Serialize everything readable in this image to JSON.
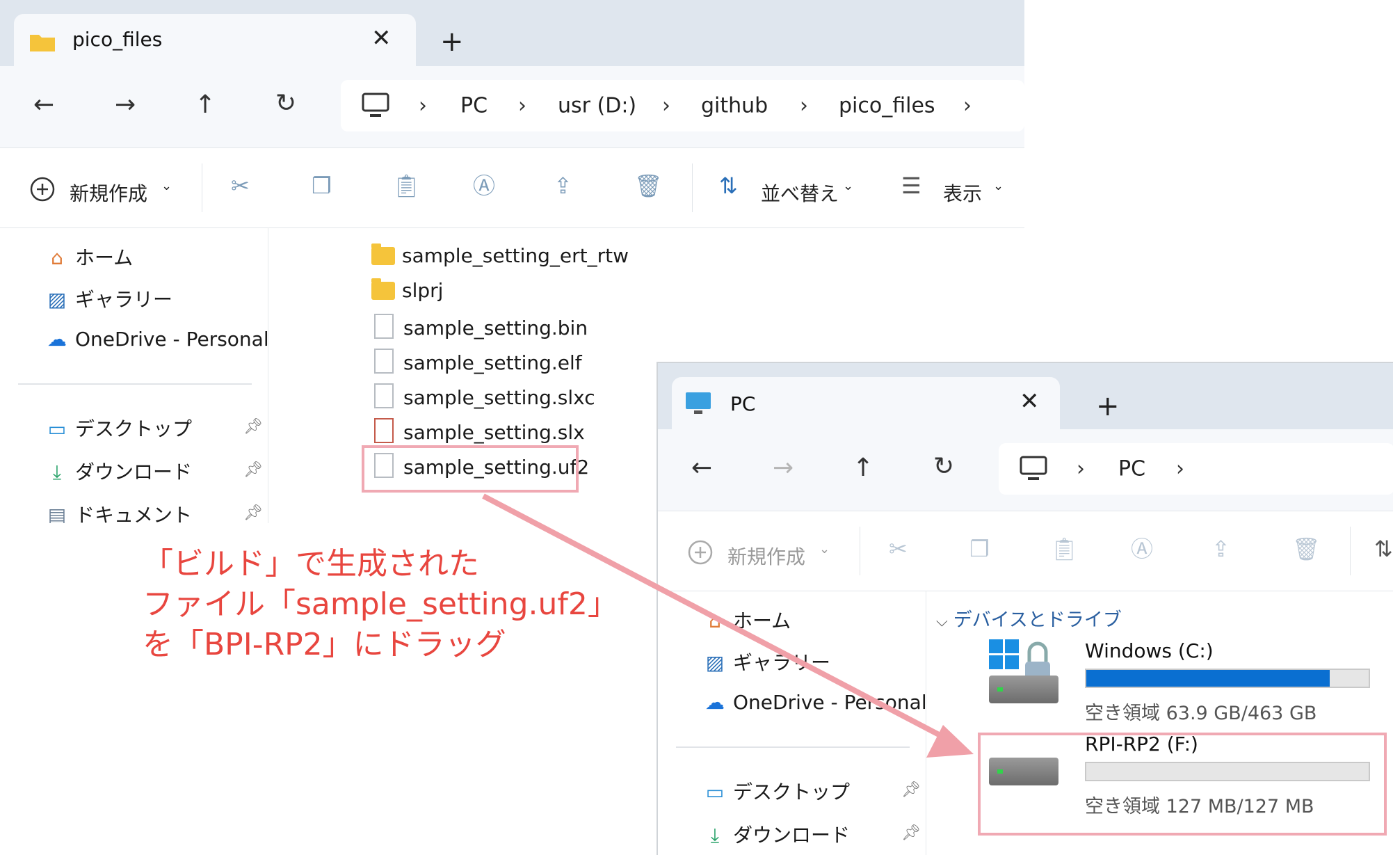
{
  "window1": {
    "tab_title": "pico_files",
    "tab_close": "✕",
    "tab_add": "+",
    "nav": {
      "back": "←",
      "forward": "→",
      "up": "↑",
      "refresh": "↻"
    },
    "breadcrumb": [
      "PC",
      "usr (D:)",
      "github",
      "pico_files"
    ],
    "chevron": "›",
    "commands": {
      "new": "新規作成",
      "sort": "並べ替え",
      "view": "表示"
    },
    "sidebar": [
      {
        "label": "ホーム",
        "icon": "home-icon"
      },
      {
        "label": "ギャラリー",
        "icon": "gallery-icon"
      },
      {
        "label": "OneDrive - Personal",
        "icon": "onedrive-icon"
      },
      {
        "label": "デスクトップ",
        "icon": "desktop-icon"
      },
      {
        "label": "ダウンロード",
        "icon": "download-icon"
      },
      {
        "label": "ドキュメント",
        "icon": "document-icon"
      }
    ],
    "files": [
      {
        "name": "sample_setting_ert_rtw",
        "type": "folder"
      },
      {
        "name": "slprj",
        "type": "folder"
      },
      {
        "name": "sample_setting.bin",
        "type": "file"
      },
      {
        "name": "sample_setting.elf",
        "type": "file"
      },
      {
        "name": "sample_setting.slxc",
        "type": "file"
      },
      {
        "name": "sample_setting.slx",
        "type": "simulink"
      },
      {
        "name": "sample_setting.uf2",
        "type": "file"
      }
    ]
  },
  "window2": {
    "tab_title": "PC",
    "tab_close": "✕",
    "tab_add": "+",
    "breadcrumb": [
      "PC"
    ],
    "commands": {
      "new": "新規作成"
    },
    "sidebar": [
      {
        "label": "ホーム",
        "icon": "home-icon"
      },
      {
        "label": "ギャラリー",
        "icon": "gallery-icon"
      },
      {
        "label": "OneDrive - Personal",
        "icon": "onedrive-icon"
      },
      {
        "label": "デスクトップ",
        "icon": "desktop-icon"
      },
      {
        "label": "ダウンロード",
        "icon": "download-icon"
      }
    ],
    "section_header": "デバイスとドライブ",
    "drives": [
      {
        "name": "Windows (C:)",
        "free": "空き領域 63.9 GB/463 GB",
        "used_fraction": 0.862
      },
      {
        "name": "RPI-RP2 (F:)",
        "free": "空き領域 127 MB/127 MB",
        "used_fraction": 0.0
      }
    ]
  },
  "annotation": {
    "lines": [
      "「ビルド」で生成された",
      "ファイル「sample_setting.uf2」",
      "を「BPI-RP2」にドラッグ"
    ],
    "color": "#e8463f",
    "arrow_color": "#f0a0a8"
  }
}
